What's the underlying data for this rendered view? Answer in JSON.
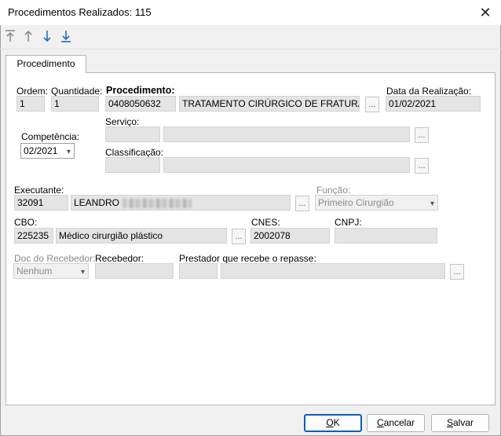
{
  "window": {
    "title": "Procedimentos Realizados: 115",
    "close_glyph": "✕"
  },
  "toolbar": {
    "icons": [
      "move-to-top-icon",
      "move-up-icon",
      "move-down-icon",
      "move-to-bottom-icon"
    ],
    "accent": "#1f6fbf",
    "disabled_color": "#8c8c8c"
  },
  "tab": {
    "label": "Procedimento"
  },
  "form": {
    "ordem": {
      "label": "Ordem:",
      "value": "1"
    },
    "quantidade": {
      "label": "Quantidade:",
      "value": "1"
    },
    "procedimento": {
      "label": "Procedimento:",
      "code": "0408050632",
      "description": "TRATAMENTO CIRÚRGICO DE FRATURA TF"
    },
    "data_realizacao": {
      "label": "Data da Realização:",
      "value": "01/02/2021"
    },
    "competencia": {
      "label": "Competência:",
      "value": "02/2021"
    },
    "servico": {
      "label": "Serviço:",
      "code": "",
      "description": ""
    },
    "classificacao": {
      "label": "Classificação:",
      "code": "",
      "description": ""
    },
    "executante": {
      "label": "Executante:",
      "code": "32091",
      "name": "LEANDRO"
    },
    "funcao": {
      "label": "Função:",
      "value": "Primeiro Cirurgião"
    },
    "cbo": {
      "label": "CBO:",
      "code": "225235",
      "description": "Médico cirurgião plástico"
    },
    "cnes": {
      "label": "CNES:",
      "value": "2002078"
    },
    "cnpj": {
      "label": "CNPJ:",
      "value": ""
    },
    "doc_recebedor": {
      "label": "Doc do Recebedor:",
      "value": "Nenhum"
    },
    "recebedor": {
      "label": "Recebedor:",
      "value": ""
    },
    "prestador": {
      "label": "Prestador que recebe o repasse:",
      "code": "",
      "name": ""
    },
    "ellipsis": "..."
  },
  "buttons": {
    "ok": {
      "accel": "O",
      "rest": "K"
    },
    "cancelar": {
      "accel": "C",
      "rest": "ancelar"
    },
    "salvar": {
      "accel": "S",
      "rest": "alvar"
    }
  }
}
